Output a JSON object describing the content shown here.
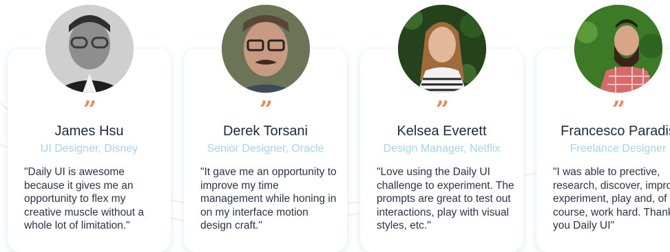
{
  "colors": {
    "accent_quote": "#e08a66",
    "name_text": "#1e2a3a",
    "role_text": "#a8d2e6",
    "body_text": "#2a3444",
    "card_bg": "#ffffff"
  },
  "testimonials": [
    {
      "quote_mark": "”",
      "name": "James Hsu",
      "role": "UI Designer, Disney",
      "quote": "\"Daily UI is awesome because it gives me an opportunity to flex my creative muscle without a whole lot of limitation.\"",
      "avatar_icon": "person-avatar"
    },
    {
      "quote_mark": "”",
      "name": "Derek Torsani",
      "role": "Senior Designer, Oracle",
      "quote": "\"It gave me an opportunity to improve my time management while honing in on my interface motion design craft.\"",
      "avatar_icon": "person-avatar"
    },
    {
      "quote_mark": "”",
      "name": "Kelsea Everett",
      "role": "Design Manager, Netflix",
      "quote": "\"Love using the Daily UI challenge to experiment. The prompts are great to test out interactions, play with visual styles, etc.\"",
      "avatar_icon": "person-avatar"
    },
    {
      "quote_mark": "”",
      "name": "Francesco Paradis",
      "role": "Freelance Designer",
      "quote": "\"I was able to prective, research, discover, improve, experiment, play and, of course, work hard. Thank you Daily UI\"",
      "avatar_icon": "person-avatar"
    }
  ]
}
